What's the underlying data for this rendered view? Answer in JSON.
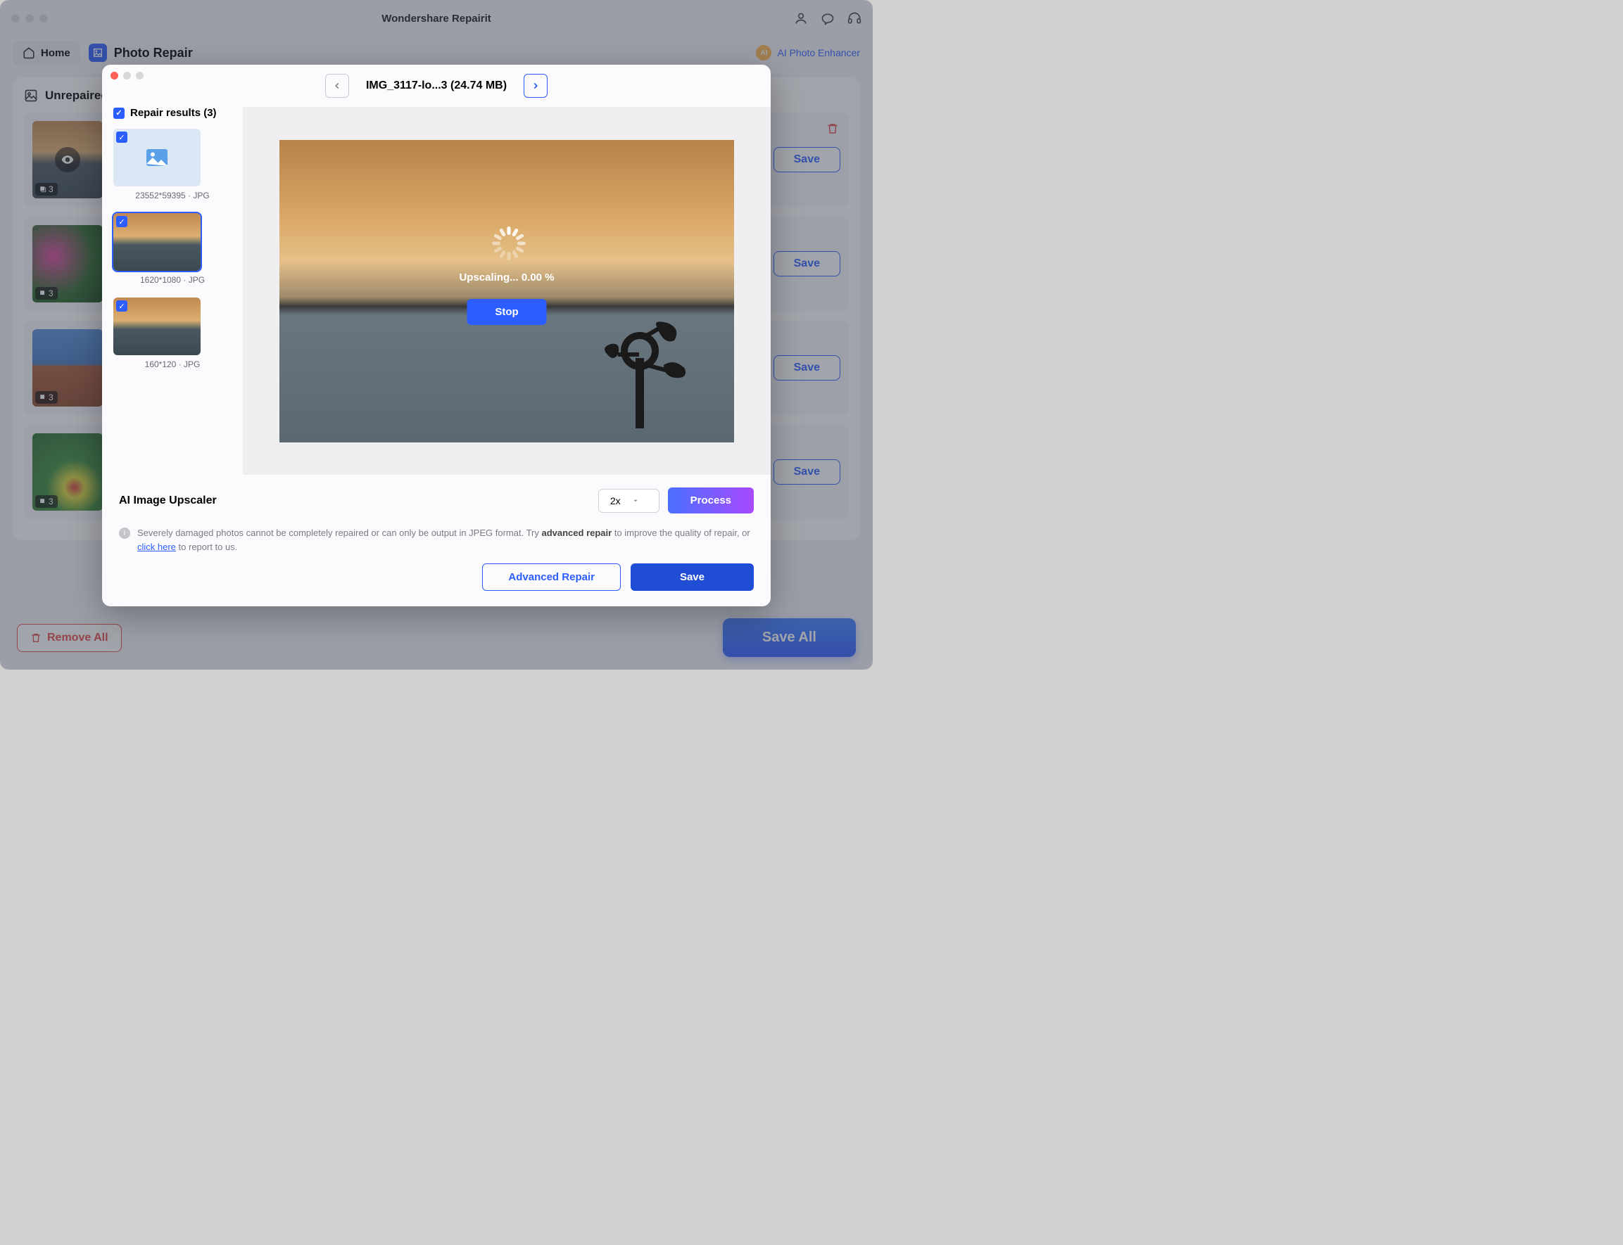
{
  "window": {
    "title": "Wondershare Repairit"
  },
  "toolbar": {
    "home": "Home",
    "section": "Photo Repair",
    "enhancer": "AI Photo Enhancer",
    "ai_badge": "AI"
  },
  "panel": {
    "title": "Unrepaired"
  },
  "cards": [
    {
      "count": "3",
      "save": "Save"
    },
    {
      "count": "3",
      "save": "Save"
    },
    {
      "count": "3",
      "save": "Save"
    },
    {
      "count": "3",
      "save": "Save"
    }
  ],
  "bottom": {
    "remove_all": "Remove All",
    "save_all": "Save All"
  },
  "modal": {
    "file": "IMG_3117-lo...3 (24.74 MB)",
    "repair_results_label": "Repair results (3)",
    "results": [
      {
        "meta": "23552*59395 · JPG"
      },
      {
        "meta": "1620*1080 · JPG"
      },
      {
        "meta": "160*120 · JPG"
      }
    ],
    "progress": "Upscaling... 0.00 %",
    "stop": "Stop",
    "upscaler_title": "AI Image Upscaler",
    "scale": "2x",
    "process": "Process",
    "info_pre": "Severely damaged photos cannot be completely repaired or can only be output in JPEG format. Try ",
    "info_bold": "advanced repair",
    "info_mid": " to improve the quality of repair, or ",
    "info_link": "click here",
    "info_post": " to report to us.",
    "advanced": "Advanced Repair",
    "save": "Save"
  }
}
